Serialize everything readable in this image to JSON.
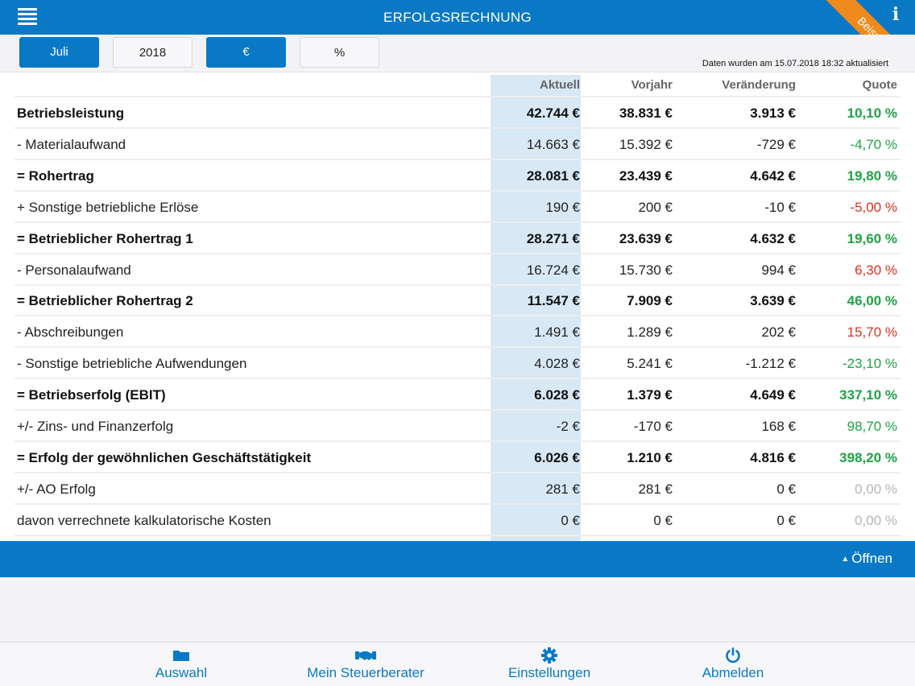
{
  "header": {
    "title": "ERFOLGSRECHNUNG",
    "ribbon": "Beispieldaten",
    "info_glyph": "i",
    "menu_icon": "hamburger-icon",
    "info_icon": "info-icon"
  },
  "toolbar": {
    "month": "Juli",
    "year": "2018",
    "currency": "€",
    "percent": "%",
    "selected": [
      "Juli",
      "€"
    ],
    "updated": "Daten wurden am 15.07.2018 18:32 aktualisiert"
  },
  "table": {
    "columns": [
      "",
      "Aktuell",
      "Vorjahr",
      "Veränderung",
      "Quote"
    ],
    "rows": [
      {
        "label": "Betriebsleistung",
        "aktuell": "42.744 €",
        "vorjahr": "38.831 €",
        "veraenderung": "3.913 €",
        "quote": "10,10 %",
        "bold": true,
        "tone": "green"
      },
      {
        "label": "- Materialaufwand",
        "aktuell": "14.663 €",
        "vorjahr": "15.392 €",
        "veraenderung": "-729 €",
        "quote": "-4,70 %",
        "bold": false,
        "tone": "green"
      },
      {
        "label": "= Rohertrag",
        "aktuell": "28.081 €",
        "vorjahr": "23.439 €",
        "veraenderung": "4.642 €",
        "quote": "19,80 %",
        "bold": true,
        "tone": "green"
      },
      {
        "label": "+ Sonstige betriebliche Erlöse",
        "aktuell": "190 €",
        "vorjahr": "200 €",
        "veraenderung": "-10 €",
        "quote": "-5,00 %",
        "bold": false,
        "tone": "red"
      },
      {
        "label": "= Betrieblicher Rohertrag 1",
        "aktuell": "28.271 €",
        "vorjahr": "23.639 €",
        "veraenderung": "4.632 €",
        "quote": "19,60 %",
        "bold": true,
        "tone": "green"
      },
      {
        "label": "- Personalaufwand",
        "aktuell": "16.724 €",
        "vorjahr": "15.730 €",
        "veraenderung": "994 €",
        "quote": "6,30 %",
        "bold": false,
        "tone": "red"
      },
      {
        "label": "= Betrieblicher Rohertrag 2",
        "aktuell": "11.547 €",
        "vorjahr": "7.909 €",
        "veraenderung": "3.639 €",
        "quote": "46,00 %",
        "bold": true,
        "tone": "green"
      },
      {
        "label": "- Abschreibungen",
        "aktuell": "1.491 €",
        "vorjahr": "1.289 €",
        "veraenderung": "202 €",
        "quote": "15,70 %",
        "bold": false,
        "tone": "red"
      },
      {
        "label": "- Sonstige betriebliche Aufwendungen",
        "aktuell": "4.028 €",
        "vorjahr": "5.241 €",
        "veraenderung": "-1.212 €",
        "quote": "-23,10 %",
        "bold": false,
        "tone": "green"
      },
      {
        "label": "= Betriebserfolg (EBIT)",
        "aktuell": "6.028 €",
        "vorjahr": "1.379 €",
        "veraenderung": "4.649 €",
        "quote": "337,10 %",
        "bold": true,
        "tone": "green"
      },
      {
        "label": "+/- Zins- und Finanzerfolg",
        "aktuell": "-2 €",
        "vorjahr": "-170 €",
        "veraenderung": "168 €",
        "quote": "98,70 %",
        "bold": false,
        "tone": "green"
      },
      {
        "label": "= Erfolg der gewöhnlichen Geschäftstätigkeit",
        "aktuell": "6.026 €",
        "vorjahr": "1.210 €",
        "veraenderung": "4.816 €",
        "quote": "398,20 %",
        "bold": true,
        "tone": "green"
      },
      {
        "label": "+/- AO Erfolg",
        "aktuell": "281 €",
        "vorjahr": "281 €",
        "veraenderung": "0 €",
        "quote": "0,00 %",
        "bold": false,
        "tone": "gray"
      },
      {
        "label": "davon verrechnete kalkulatorische Kosten",
        "aktuell": "0 €",
        "vorjahr": "0 €",
        "veraenderung": "0 €",
        "quote": "0,00 %",
        "bold": false,
        "tone": "gray"
      }
    ]
  },
  "panel": {
    "open_label": "Öffnen",
    "chevron_icon": "chevron-up-icon"
  },
  "tabbar": {
    "items": [
      {
        "label": "Auswahl",
        "icon": "folder-icon"
      },
      {
        "label": "Mein Steuerberater",
        "icon": "handshake-icon"
      },
      {
        "label": "Einstellungen",
        "icon": "gear-icon"
      },
      {
        "label": "Abmelden",
        "icon": "power-icon"
      }
    ]
  },
  "colors": {
    "brand": "#0979c6",
    "ribbon": "#f08a1c",
    "positive": "#1fa345",
    "negative": "#e0301e",
    "neutral": "#b5b5b8",
    "current_column": "#d8e8f5"
  }
}
